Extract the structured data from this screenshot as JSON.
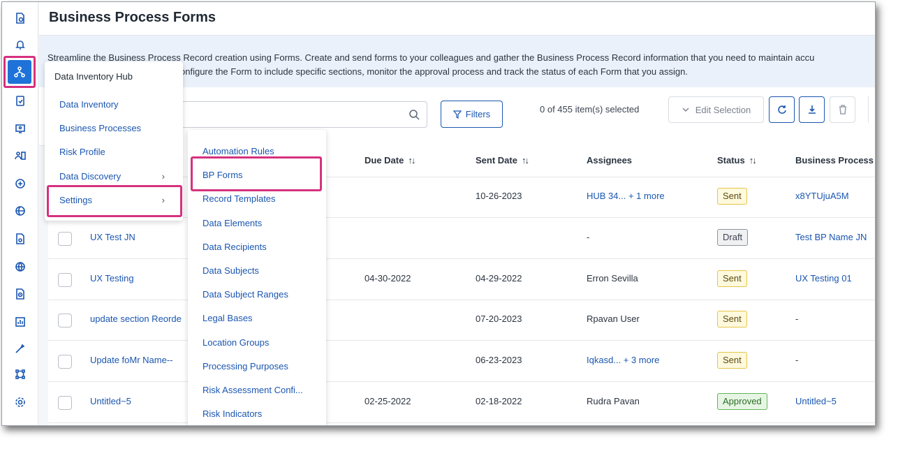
{
  "page": {
    "title": "Business Process Forms",
    "description_line1": "Streamline the Business Process Record creation using Forms. Create and send forms to your colleagues and gather the Business Process Record information that you need to maintain accu",
    "description_line2": "onfigure the Form to include specific sections, monitor the approval process and track the status of each Form that you assign."
  },
  "rail": {
    "icons": [
      "dashboard-icon",
      "bell-icon",
      "data-inventory-icon",
      "assessment-icon",
      "monitor-icon",
      "users-icon",
      "vendor-icon",
      "globe-privacy-icon",
      "document-settings-icon",
      "globe-icon",
      "timer-document-icon",
      "report-icon",
      "tools-icon",
      "integration-icon",
      "settings-icon"
    ]
  },
  "toolbar": {
    "filters_label": "Filters",
    "selection_count": "0 of 455 item(s) selected",
    "edit_selection_label": "Edit Selection"
  },
  "table": {
    "headers": {
      "due_date": "Due Date",
      "sent_date": "Sent Date",
      "assignees": "Assignees",
      "status": "Status",
      "business_process": "Business Process"
    },
    "rows": [
      {
        "name": "",
        "due_date": "",
        "sent_date": "10-26-2023",
        "assignees": "HUB 34... + 1 more",
        "status": "Sent",
        "business_process": "x8YTUjuA5M"
      },
      {
        "name": "UX Test JN",
        "due_date": "",
        "sent_date": "",
        "assignees": "-",
        "status": "Draft",
        "business_process": "Test BP Name JN"
      },
      {
        "name": "UX Testing",
        "due_date": "04-30-2022",
        "sent_date": "04-29-2022",
        "assignees": "Erron Sevilla",
        "status": "Sent",
        "business_process": "UX Testing 01"
      },
      {
        "name": "update section Reorde",
        "due_date": "",
        "sent_date": "07-20-2023",
        "assignees": "Rpavan User",
        "status": "Sent",
        "business_process": "-"
      },
      {
        "name": "Update foMr Name--",
        "due_date": "",
        "sent_date": "06-23-2023",
        "assignees": "Iqkasd... + 3 more",
        "status": "Sent",
        "business_process": "-"
      },
      {
        "name": "Untitled~5",
        "due_date": "02-25-2022",
        "sent_date": "02-18-2022",
        "assignees": "Rudra Pavan",
        "status": "Approved",
        "business_process": "Untitled~5"
      }
    ]
  },
  "menu_primary": {
    "title": "Data Inventory Hub",
    "items": [
      "Data Inventory",
      "Business Processes",
      "Risk Profile",
      "Data Discovery",
      "Settings"
    ]
  },
  "menu_settings": {
    "items": [
      "Automation Rules",
      "BP Forms",
      "Record Templates",
      "Data Elements",
      "Data Recipients",
      "Data Subjects",
      "Data Subject Ranges",
      "Legal Bases",
      "Location Groups",
      "Processing Purposes",
      "Risk Assessment Confi...",
      "Risk Indicators"
    ]
  },
  "colors": {
    "accent": "#1a56b0",
    "highlight": "#d6317e",
    "active_rail": "#1e72d8"
  }
}
